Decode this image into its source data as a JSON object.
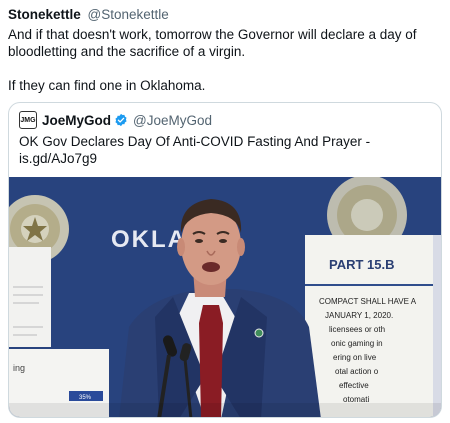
{
  "tweet": {
    "author_name": "Stonekettle",
    "author_handle": "@Stonekettle",
    "paragraphs": [
      "And if that doesn't work, tomorrow the Governor will declare a day of bloodletting and the sacrifice of a virgin.",
      "If they can find one in Oklahoma."
    ]
  },
  "quote": {
    "avatar_text": "JMG",
    "author_name": "JoeMyGod",
    "verified_icon": "verified-badge-icon",
    "author_handle": "@JoeMyGod",
    "text": "OK Gov Declares Day Of Anti-COVID Fasting And Prayer - is.gd/AJo7g9"
  },
  "media": {
    "backdrop_text": "OKLA",
    "sign_title": "PART 15.B",
    "sign_lines": [
      "COMPACT SHALL HAVE A",
      "JANUARY 1, 2020.",
      "licensees or oth",
      "onic gaming in",
      "ering on live",
      "otal action o",
      "effective",
      "otomati"
    ],
    "left_board_label": "ing",
    "left_board_stat": "35%",
    "colors": {
      "backdrop": "#2f4d8c",
      "suit": "#2a3f73",
      "tie": "#8a1c24",
      "shirt": "#f0f0f2",
      "seal": "#d8d2b8"
    }
  }
}
